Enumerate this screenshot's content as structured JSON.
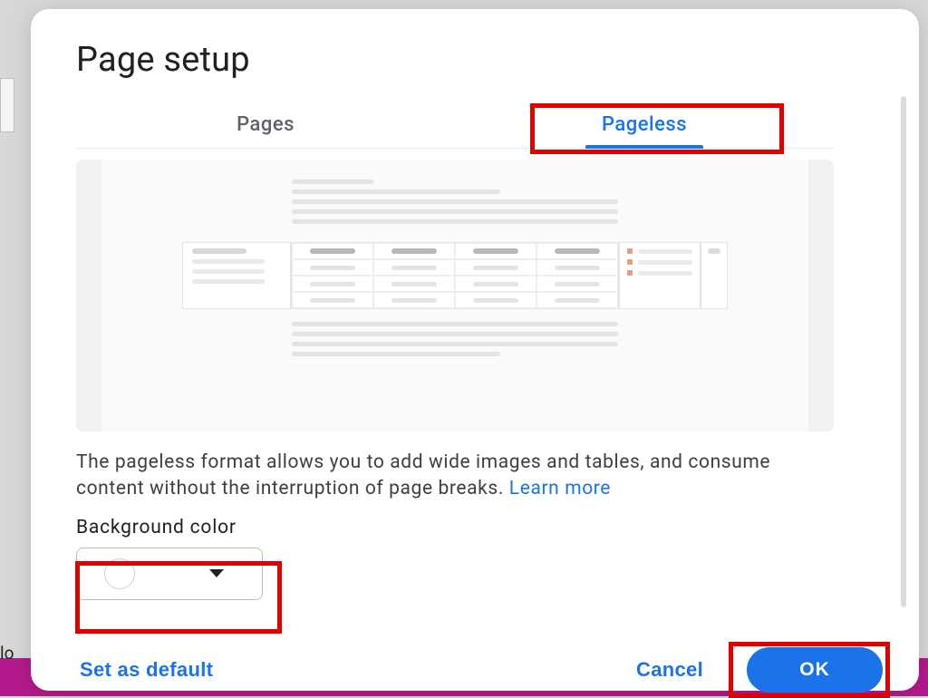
{
  "dialog": {
    "title": "Page setup",
    "tabs": [
      {
        "label": "Pages"
      },
      {
        "label": "Pageless"
      }
    ],
    "active_tab_index": 1,
    "description_text": "The pageless format allows you to add wide images and tables, and consume content without the interruption of page breaks. ",
    "learn_more_label": "Learn more",
    "background_color_label": "Background color",
    "background_color_value": "#ffffff",
    "footer": {
      "set_default_label": "Set as default",
      "cancel_label": "Cancel",
      "ok_label": "OK"
    }
  },
  "background_cutoff_text": "lo"
}
